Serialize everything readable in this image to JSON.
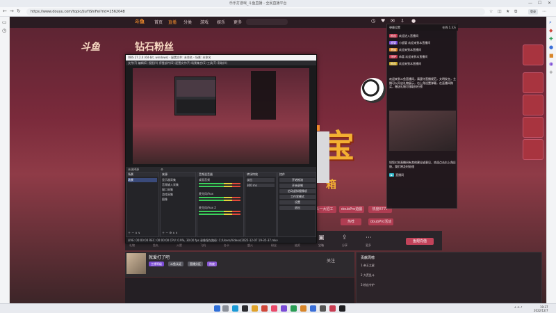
{
  "browser": {
    "tab_title": "乐乐打游戏_斗鱼直播 - 全民直播平台",
    "url": "https://www.douyu.com/topic/JiuYiShiFei?rid=2562048",
    "profile_label": "登录",
    "window_controls": [
      "—",
      "☐",
      "✕"
    ]
  },
  "site": {
    "logo": "斗鱼",
    "nav_links": [
      "首页",
      "直播",
      "分类",
      "游戏",
      "娱乐",
      "更多"
    ],
    "brand": "斗鱼",
    "brand_banner": "钻石粉丝",
    "hero_glyph": "宝",
    "hero_glyph_sub": "箱",
    "promo_pills": [
      "头一大招工",
      "doubPro遊戲",
      "热度8777",
      "热荐",
      "doubPro活动"
    ]
  },
  "chat": {
    "header": "弹幕设置",
    "online": "在线 1.3万",
    "messages": [
      {
        "badge": "粉丝",
        "badge_color": "#c83c52",
        "text": "欢迎进入直播间"
      },
      {
        "badge": "超管",
        "badge_color": "#7b4bd6",
        "text": "小超管 欢迎来到本直播间"
      },
      {
        "badge": "贵族",
        "badge_color": "#d8862a",
        "text": "欢迎来到本直播间"
      },
      {
        "badge": "守护",
        "badge_color": "#c83c52",
        "text": "恭喜 欢迎来到本直播间"
      },
      {
        "badge": "粉丝",
        "badge_color": "#c8a52a",
        "text": "欢迎来到本直播间"
      }
    ],
    "notice_1": "欢迎来到斗鱼直播间，请遵守直播规范，文明发言，主播可以开启礼物展示，右上角设置弹幕，在直播间购买，赠送礼物可领取排行榜",
    "notice_2": "如您对本直播间有其他建议或意见，欢迎点击右上角反馈，我们将及时处理",
    "chat_tail": "直播间"
  },
  "obs": {
    "title": "OBS 27.2.4 (64-bit, windows) - 配置文件: 未命名 - 场景: 未命名",
    "menu": [
      "文件(F)",
      "编辑(E)",
      "视图(V)",
      "停靠部件(D)",
      "配置文件(P)",
      "场景集合(S)",
      "工具(T)",
      "帮助(H)"
    ],
    "ctrl_row": "未选择源",
    "docks": {
      "scenes": {
        "title": "场景",
        "items": [
          "场景"
        ]
      },
      "sources": {
        "title": "来源",
        "items": [
          "显示器采集",
          "音频输入采集",
          "窗口采集",
          "游戏采集",
          "图像"
        ]
      },
      "mixer": {
        "title": "音频混音器",
        "items": [
          "桌面音频",
          "麦克风/Aux",
          "麦克风/Aux 2"
        ]
      },
      "transitions": {
        "title": "转场特效",
        "fade": "淡出",
        "duration": "300 ms"
      },
      "controls": {
        "title": "控件",
        "buttons": [
          "开始推流",
          "开始录制",
          "启动虚拟摄像机",
          "工作室模式",
          "设置",
          "退出"
        ]
      }
    },
    "status": "LIVE: 00:00:00   REC: 00:00:00   CPU: 0.9%, 30.00 fps   录像保存路径: C:/Users/Videos/2022-12-07 19-35-37.mkv"
  },
  "gifts": {
    "items": [
      "礼物",
      "鱼丸",
      "火箭",
      "飞机",
      "办卡",
      "超火",
      "粉丝",
      "抽奖",
      "宝箱",
      "分享",
      "更多"
    ],
    "balance_label": "鱼翅充值"
  },
  "anchor": {
    "name": "就爱打了吧",
    "tags": [
      "主播等级",
      "斗鱼认证",
      "直播分区",
      "热度"
    ],
    "follow": "关注"
  },
  "ranking": {
    "title": "贡献周榜",
    "rows": [
      "1  帝王之星",
      "2  大荒乱斗",
      "3  粉丝守护"
    ]
  },
  "taskbar": {
    "time": "19:37",
    "date": "2022/12/7"
  },
  "colors": {
    "accent": "#f08b2c",
    "page_red": "#7a2a3b",
    "douyu_pink": "#c2435a"
  }
}
